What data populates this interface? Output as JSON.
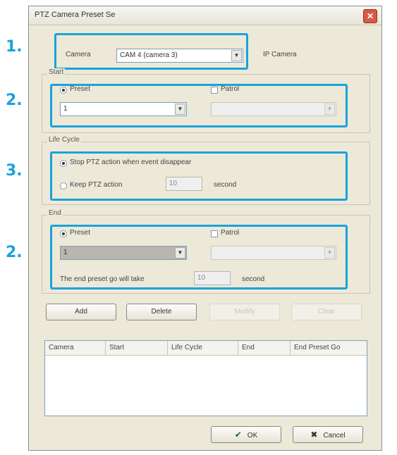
{
  "annotations": [
    "1.",
    "2.",
    "3.",
    "2."
  ],
  "dialog": {
    "title": "PTZ Camera Preset Se",
    "close_symbol": "✕"
  },
  "camera": {
    "label": "Camera",
    "value": "CAM 4 (camera 3)",
    "type_text": "IP Camera"
  },
  "start": {
    "group_label": "Start",
    "preset_label": "Preset",
    "patrol_label": "Patrol",
    "preset_value": "1",
    "patrol_value": ""
  },
  "life_cycle": {
    "group_label": "Life Cycle",
    "option1": "Stop PTZ action when event disappear",
    "option2": "Keep PTZ action",
    "seconds_value": "10",
    "seconds_unit": "second"
  },
  "end": {
    "group_label": "End",
    "preset_label": "Preset",
    "patrol_label": "Patrol",
    "preset_value": "1",
    "patrol_value": "",
    "go_text": "The end preset go will take",
    "go_seconds": "10",
    "go_unit": "second"
  },
  "buttons": {
    "add": "Add",
    "delete": "Delete",
    "modify": "Modify",
    "clear": "Clear"
  },
  "table": {
    "columns": [
      "Camera",
      "Start",
      "Life Cycle",
      "End",
      "End Preset Go"
    ]
  },
  "footer": {
    "ok_icon": "✔",
    "ok": "OK",
    "cancel_icon": "✖",
    "cancel": "Cancel"
  }
}
